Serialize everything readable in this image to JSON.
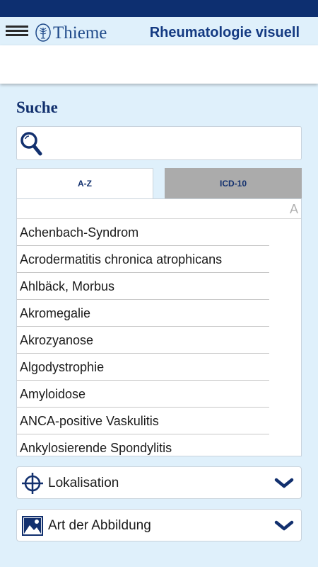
{
  "header": {
    "logo_text": "Thieme",
    "app_title": "Rheumatologie visuell"
  },
  "search": {
    "title": "Suche",
    "value": "",
    "placeholder": ""
  },
  "tabs": [
    {
      "label": "A-Z",
      "active": true
    },
    {
      "label": "ICD-10",
      "active": false
    }
  ],
  "index_letter": "A",
  "list": {
    "items": [
      "Achenbach-Syndrom",
      "Acrodermatitis chronica atrophicans",
      "Ahlbäck, Morbus",
      "Akromegalie",
      "Akrozyanose",
      "Algodystrophie",
      "Amyloidose",
      "ANCA-positive Vaskulitis",
      "Ankylosierende Spondylitis"
    ]
  },
  "filters": {
    "localisation_label": "Lokalisation",
    "image_type_label": "Art der Abbildung"
  },
  "colors": {
    "primary_navy": "#12306e",
    "status_bar": "#0d2f70",
    "background": "#dff0fb",
    "inactive_tab": "#ababab"
  },
  "icons": {
    "menu": "hamburger-icon",
    "search": "magnifier-icon",
    "localisation": "crosshair-icon",
    "image_type": "image-icon",
    "expand": "chevron-down-icon"
  }
}
